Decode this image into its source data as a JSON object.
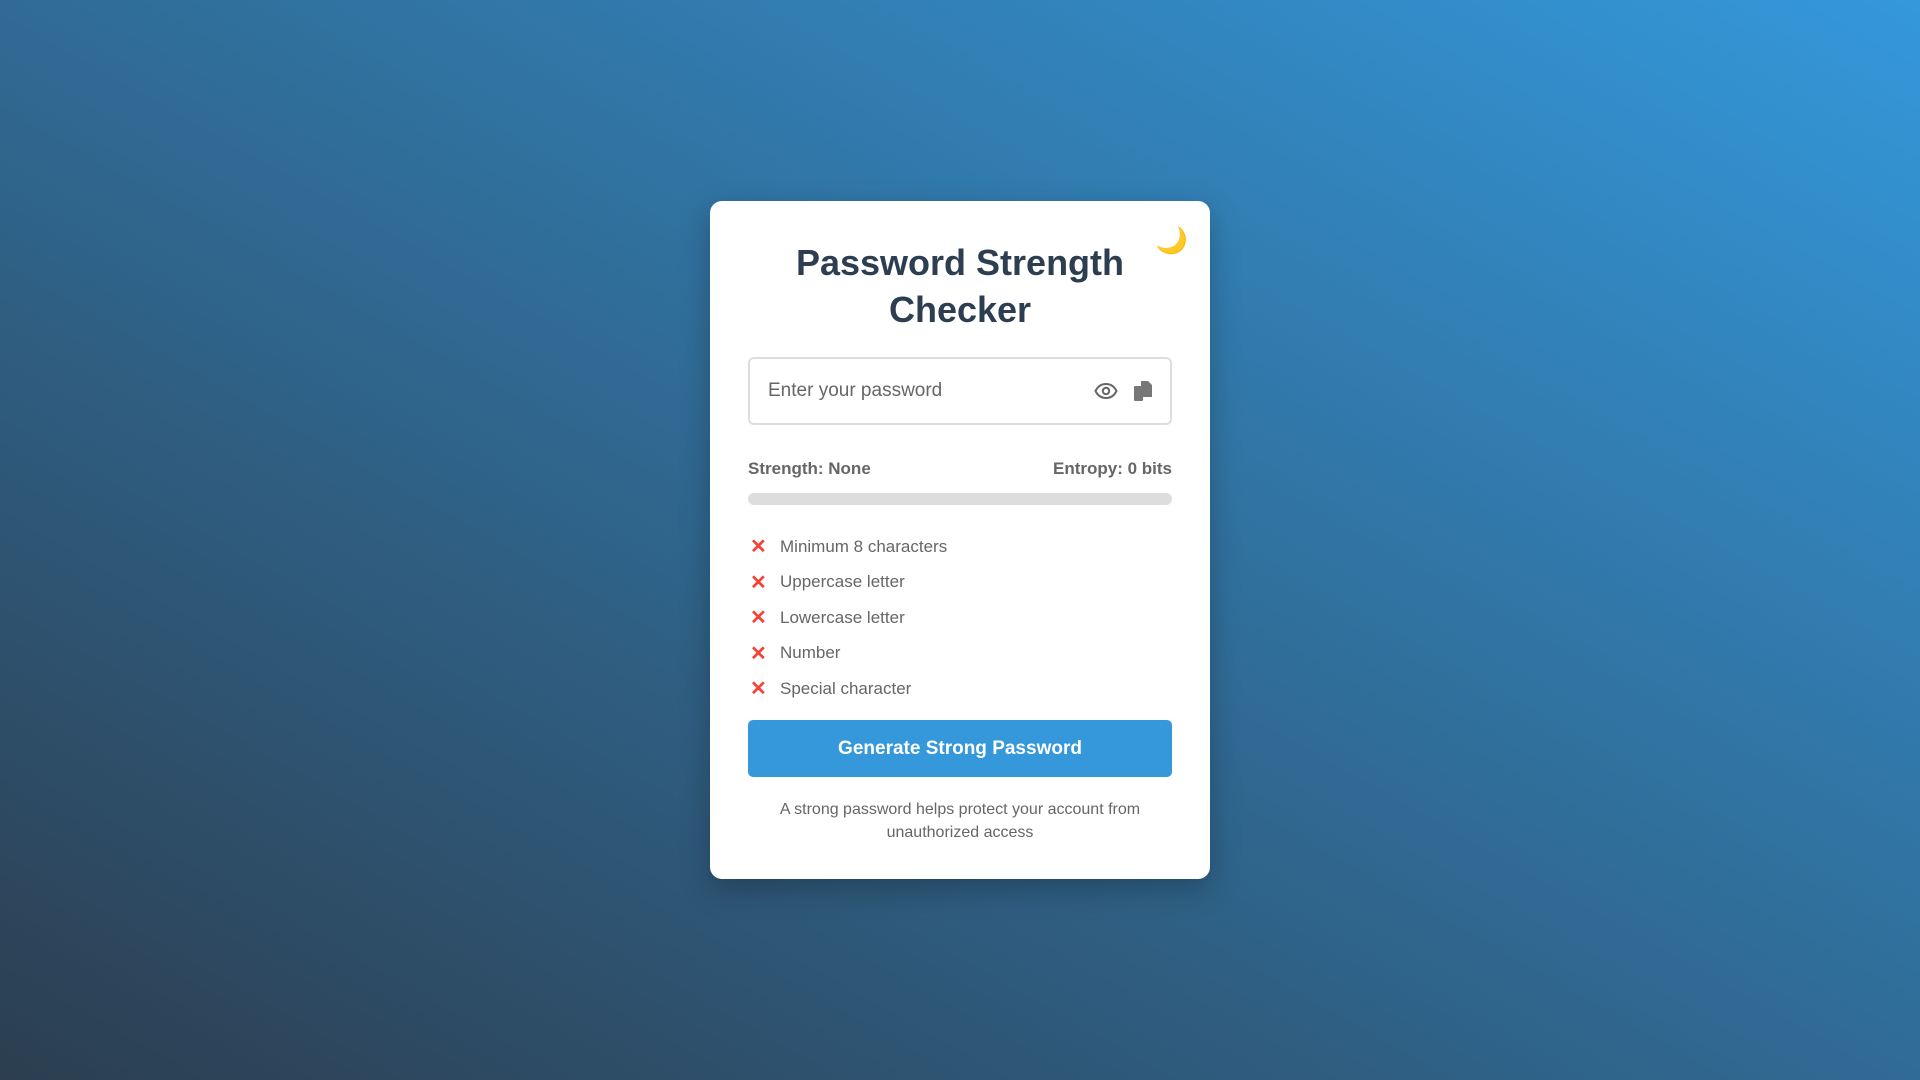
{
  "title": "Password Strength Checker",
  "theme_toggle_icon": "crescent-moon",
  "theme_toggle_glyph": "🌙",
  "password": {
    "value": "",
    "placeholder": "Enter your password"
  },
  "strength_label": "Strength: None",
  "entropy_label": "Entropy: 0 bits",
  "strength_progress": 0,
  "requirements": [
    {
      "label": "Minimum 8 characters",
      "met": false,
      "mark": "✕"
    },
    {
      "label": "Uppercase letter",
      "met": false,
      "mark": "✕"
    },
    {
      "label": "Lowercase letter",
      "met": false,
      "mark": "✕"
    },
    {
      "label": "Number",
      "met": false,
      "mark": "✕"
    },
    {
      "label": "Special character",
      "met": false,
      "mark": "✕"
    }
  ],
  "generate_button": "Generate Strong Password",
  "footer_text": "A strong password helps protect your account from unauthorized access",
  "colors": {
    "accent": "#3498db",
    "title": "#2c3e50",
    "fail": "#f44336",
    "bg_start": "#2c3e50",
    "bg_end": "#3498db"
  }
}
